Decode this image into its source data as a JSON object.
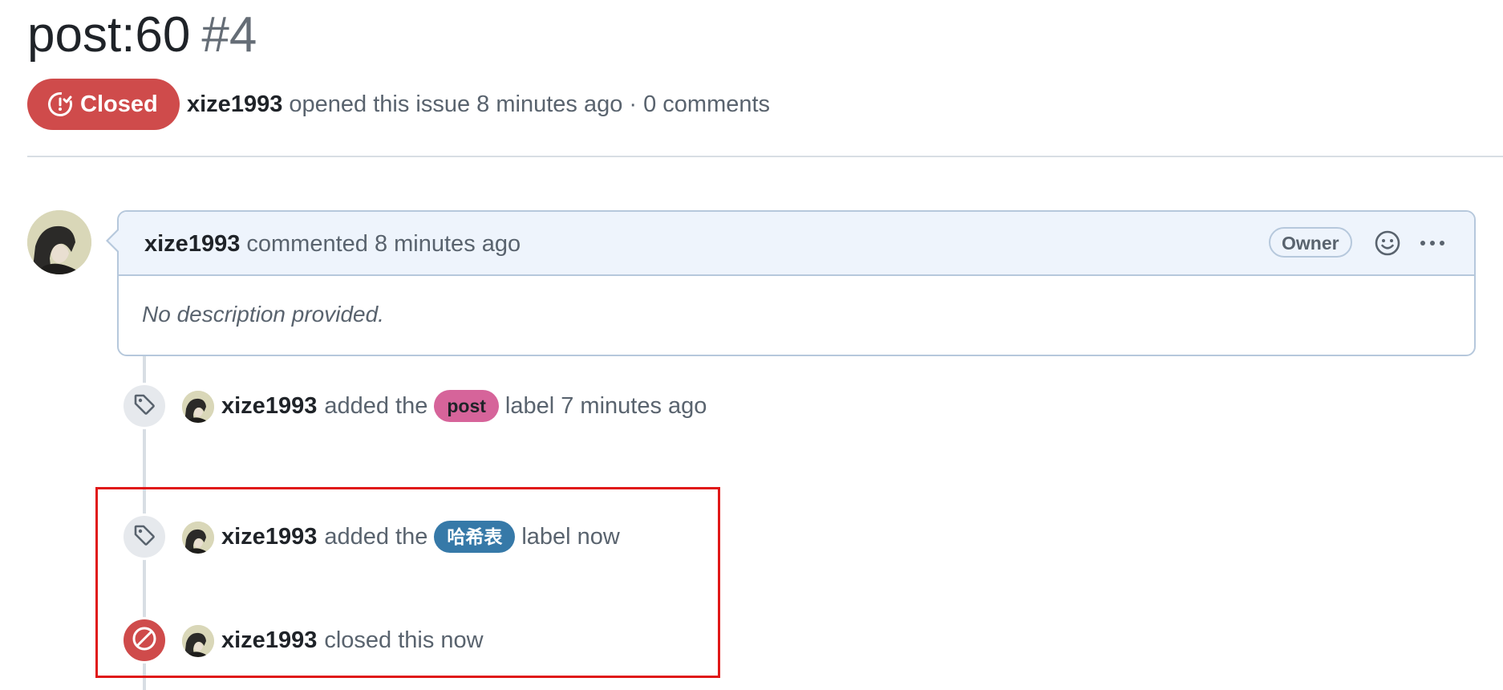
{
  "issue": {
    "title": "post:60",
    "number": "#4",
    "state_label": "Closed",
    "author": "xize1993",
    "opened_text": "opened this issue 8 minutes ago · 0 comments"
  },
  "comment": {
    "author": "xize1993",
    "action": "commented 8 minutes ago",
    "role_badge": "Owner",
    "body": "No description provided."
  },
  "timeline": [
    {
      "actor": "xize1993",
      "prefix": "added the",
      "label": "post",
      "label_color": "#d6649a",
      "suffix": "label 7 minutes ago"
    },
    {
      "actor": "xize1993",
      "prefix": "added the",
      "label": "哈希表",
      "label_color": "#3679a8",
      "suffix": "label now"
    },
    {
      "actor": "xize1993",
      "text": "closed this now"
    }
  ],
  "colors": {
    "closed_red": "#cf4b4b",
    "highlight_box": "#e01818",
    "comment_header_bg": "#eef4fc"
  },
  "icons": [
    "issue-closed-icon",
    "smiley-icon",
    "kebab-horizontal-icon",
    "tag-icon",
    "skip-icon"
  ]
}
